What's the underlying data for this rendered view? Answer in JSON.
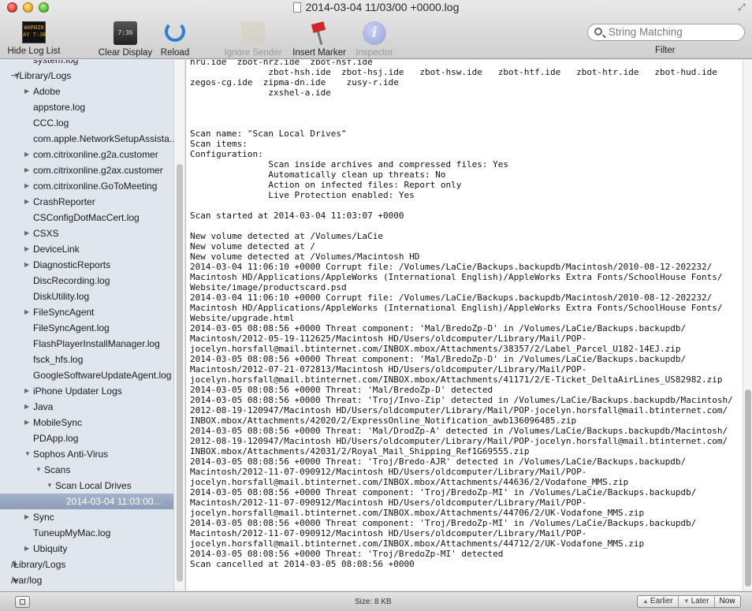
{
  "window": {
    "title": "2014-03-04 11/03/00 +0000.log"
  },
  "toolbar": {
    "hide_log_list": "Hide Log List",
    "hide_log_list_icon_text": "WARNIN\nAY 7:36",
    "clear_display": "Clear Display",
    "clear_display_icon_text": "7:36",
    "reload": "Reload",
    "ignore_sender": "Ignore Sender",
    "insert_marker": "Insert Marker",
    "inspector": "Inspector",
    "search_placeholder": "String Matching",
    "filter": "Filter"
  },
  "sidebar": {
    "items": [
      {
        "label": "system.log",
        "indent": 1,
        "expandable": false,
        "expanded": false
      },
      {
        "label": "~/Library/Logs",
        "indent": 0,
        "expandable": true,
        "expanded": true
      },
      {
        "label": "Adobe",
        "indent": 1,
        "expandable": true,
        "expanded": false
      },
      {
        "label": "appstore.log",
        "indent": 1,
        "expandable": false,
        "expanded": false
      },
      {
        "label": "CCC.log",
        "indent": 1,
        "expandable": false,
        "expanded": false
      },
      {
        "label": "com.apple.NetworkSetupAssista...",
        "indent": 1,
        "expandable": false,
        "expanded": false
      },
      {
        "label": "com.citrixonline.g2a.customer",
        "indent": 1,
        "expandable": true,
        "expanded": false
      },
      {
        "label": "com.citrixonline.g2ax.customer",
        "indent": 1,
        "expandable": true,
        "expanded": false
      },
      {
        "label": "com.citrixonline.GoToMeeting",
        "indent": 1,
        "expandable": true,
        "expanded": false
      },
      {
        "label": "CrashReporter",
        "indent": 1,
        "expandable": true,
        "expanded": false
      },
      {
        "label": "CSConfigDotMacCert.log",
        "indent": 1,
        "expandable": false,
        "expanded": false
      },
      {
        "label": "CSXS",
        "indent": 1,
        "expandable": true,
        "expanded": false
      },
      {
        "label": "DeviceLink",
        "indent": 1,
        "expandable": true,
        "expanded": false
      },
      {
        "label": "DiagnosticReports",
        "indent": 1,
        "expandable": true,
        "expanded": false
      },
      {
        "label": "DiscRecording.log",
        "indent": 1,
        "expandable": false,
        "expanded": false
      },
      {
        "label": "DiskUtility.log",
        "indent": 1,
        "expandable": false,
        "expanded": false
      },
      {
        "label": "FileSyncAgent",
        "indent": 1,
        "expandable": true,
        "expanded": false
      },
      {
        "label": "FileSyncAgent.log",
        "indent": 1,
        "expandable": false,
        "expanded": false
      },
      {
        "label": "FlashPlayerInstallManager.log",
        "indent": 1,
        "expandable": false,
        "expanded": false
      },
      {
        "label": "fsck_hfs.log",
        "indent": 1,
        "expandable": false,
        "expanded": false
      },
      {
        "label": "GoogleSoftwareUpdateAgent.log",
        "indent": 1,
        "expandable": false,
        "expanded": false
      },
      {
        "label": "iPhone Updater Logs",
        "indent": 1,
        "expandable": true,
        "expanded": false
      },
      {
        "label": "Java",
        "indent": 1,
        "expandable": true,
        "expanded": false
      },
      {
        "label": "MobileSync",
        "indent": 1,
        "expandable": true,
        "expanded": false
      },
      {
        "label": "PDApp.log",
        "indent": 1,
        "expandable": false,
        "expanded": false
      },
      {
        "label": "Sophos Anti-Virus",
        "indent": 1,
        "expandable": true,
        "expanded": true
      },
      {
        "label": "Scans",
        "indent": 2,
        "expandable": true,
        "expanded": true
      },
      {
        "label": "Scan Local Drives",
        "indent": 3,
        "expandable": true,
        "expanded": true
      },
      {
        "label": "2014-03-04 11:03:00...",
        "indent": 4,
        "expandable": false,
        "expanded": false,
        "selected": true
      },
      {
        "label": "Sync",
        "indent": 1,
        "expandable": true,
        "expanded": false
      },
      {
        "label": "TuneupMyMac.log",
        "indent": 1,
        "expandable": false,
        "expanded": false
      },
      {
        "label": "Ubiquity",
        "indent": 1,
        "expandable": true,
        "expanded": false
      },
      {
        "label": "/Library/Logs",
        "indent": 0,
        "expandable": true,
        "expanded": false
      },
      {
        "label": "/var/log",
        "indent": 0,
        "expandable": true,
        "expanded": false
      }
    ]
  },
  "log": {
    "lines": [
      "hru.ide  zbot-hrz.ide  zbot-hsf.ide",
      "               zbot-hsh.ide  zbot-hsj.ide   zbot-hsw.ide   zbot-htf.ide   zbot-htr.ide   zbot-hud.ide",
      "zegos-cg.ide  zipma-dn.ide    zusy-r.ide",
      "               zxshel-a.ide",
      "",
      "",
      "",
      "Scan name: \"Scan Local Drives\"",
      "Scan items:",
      "Configuration:",
      "               Scan inside archives and compressed files: Yes",
      "               Automatically clean up threats: No",
      "               Action on infected files: Report only",
      "               Live Protection enabled: Yes",
      "",
      "Scan started at 2014-03-04 11:03:07 +0000",
      "",
      "New volume detected at /Volumes/LaCie",
      "New volume detected at /",
      "New volume detected at /Volumes/Macintosh HD",
      "2014-03-04 11:06:10 +0000 Corrupt file: /Volumes/LaCie/Backups.backupdb/Macintosh/2010-08-12-202232/",
      "Macintosh HD/Applications/AppleWorks (International English)/AppleWorks Extra Fonts/SchoolHouse Fonts/",
      "Website/image/productscard.psd",
      "2014-03-04 11:06:10 +0000 Corrupt file: /Volumes/LaCie/Backups.backupdb/Macintosh/2010-08-12-202232/",
      "Macintosh HD/Applications/AppleWorks (International English)/AppleWorks Extra Fonts/SchoolHouse Fonts/",
      "Website/upgrade.html",
      "2014-03-05 08:08:56 +0000 Threat component: 'Mal/BredoZp-D' in /Volumes/LaCie/Backups.backupdb/",
      "Macintosh/2012-05-19-112625/Macintosh HD/Users/oldcomputer/Library/Mail/POP-",
      "jocelyn.horsfall@mail.btinternet.com/INBOX.mbox/Attachments/38357/2/Label_Parcel_U182-14EJ.zip",
      "2014-03-05 08:08:56 +0000 Threat component: 'Mal/BredoZp-D' in /Volumes/LaCie/Backups.backupdb/",
      "Macintosh/2012-07-21-072813/Macintosh HD/Users/oldcomputer/Library/Mail/POP-",
      "jocelyn.horsfall@mail.btinternet.com/INBOX.mbox/Attachments/41171/2/E-Ticket_DeltaAirLines_US82982.zip",
      "2014-03-05 08:08:56 +0000 Threat: 'Mal/BredoZp-D' detected",
      "2014-03-05 08:08:56 +0000 Threat: 'Troj/Invo-Zip' detected in /Volumes/LaCie/Backups.backupdb/Macintosh/",
      "2012-08-19-120947/Macintosh HD/Users/oldcomputer/Library/Mail/POP-jocelyn.horsfall@mail.btinternet.com/",
      "INBOX.mbox/Attachments/42020/2/ExpressOnline_Notification_awb136096485.zip",
      "2014-03-05 08:08:56 +0000 Threat: 'Mal/DrodZp-A' detected in /Volumes/LaCie/Backups.backupdb/Macintosh/",
      "2012-08-19-120947/Macintosh HD/Users/oldcomputer/Library/Mail/POP-jocelyn.horsfall@mail.btinternet.com/",
      "INBOX.mbox/Attachments/42031/2/Royal_Mail_Shipping_Ref1G69555.zip",
      "2014-03-05 08:08:56 +0000 Threat: 'Troj/Bredo-AJR' detected in /Volumes/LaCie/Backups.backupdb/",
      "Macintosh/2012-11-07-090912/Macintosh HD/Users/oldcomputer/Library/Mail/POP-",
      "jocelyn.horsfall@mail.btinternet.com/INBOX.mbox/Attachments/44636/2/Vodafone_MMS.zip",
      "2014-03-05 08:08:56 +0000 Threat component: 'Troj/BredoZp-MI' in /Volumes/LaCie/Backups.backupdb/",
      "Macintosh/2012-11-07-090912/Macintosh HD/Users/oldcomputer/Library/Mail/POP-",
      "jocelyn.horsfall@mail.btinternet.com/INBOX.mbox/Attachments/44706/2/UK-Vodafone_MMS.zip",
      "2014-03-05 08:08:56 +0000 Threat component: 'Troj/BredoZp-MI' in /Volumes/LaCie/Backups.backupdb/",
      "Macintosh/2012-11-07-090912/Macintosh HD/Users/oldcomputer/Library/Mail/POP-",
      "jocelyn.horsfall@mail.btinternet.com/INBOX.mbox/Attachments/44712/2/UK-Vodafone_MMS.zip",
      "2014-03-05 08:08:56 +0000 Threat: 'Troj/BredoZp-MI' detected",
      "Scan cancelled at 2014-03-05 08:08:56 +0000"
    ]
  },
  "bottombar": {
    "size_label": "Size: 8 KB",
    "earlier": "Earlier",
    "later": "Later",
    "now": "Now"
  },
  "colors": {
    "sidebar_bg": "#e0e6ee",
    "selection": "#95a5c0"
  }
}
